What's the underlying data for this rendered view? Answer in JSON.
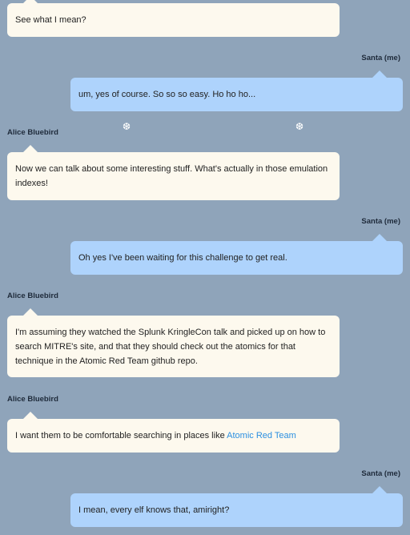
{
  "messages": [
    {
      "sender": "",
      "text": "See what I mean?"
    },
    {
      "sender": "Santa (me)",
      "text": "um, yes of course. So so so easy. Ho ho ho..."
    },
    {
      "sender": "Alice Bluebird",
      "text": "Now we can talk about some interesting stuff. What's actually in those emulation indexes!"
    },
    {
      "sender": "Santa (me)",
      "text": "Oh yes I've been waiting for this challenge to get real."
    },
    {
      "sender": "Alice Bluebird",
      "text": "I'm assuming they watched the Splunk KringleCon talk and picked up on how to search MITRE's site, and that they should check out the atomics for that technique in the Atomic Red Team github repo."
    },
    {
      "sender": "Alice Bluebird",
      "text": "I want them to be comfortable searching in places like ",
      "link": "Atomic Red Team"
    },
    {
      "sender": "Santa (me)",
      "text": "I mean, every elf knows that, amiright?"
    }
  ],
  "decor": {
    "snowflake": "❆",
    "snowflake_icon": "snowflake-icon"
  },
  "colors": {
    "background": "#8fa4ba",
    "them_bubble": "#fdf9ee",
    "me_bubble": "#aed3fc",
    "link": "#2b8fe0"
  }
}
